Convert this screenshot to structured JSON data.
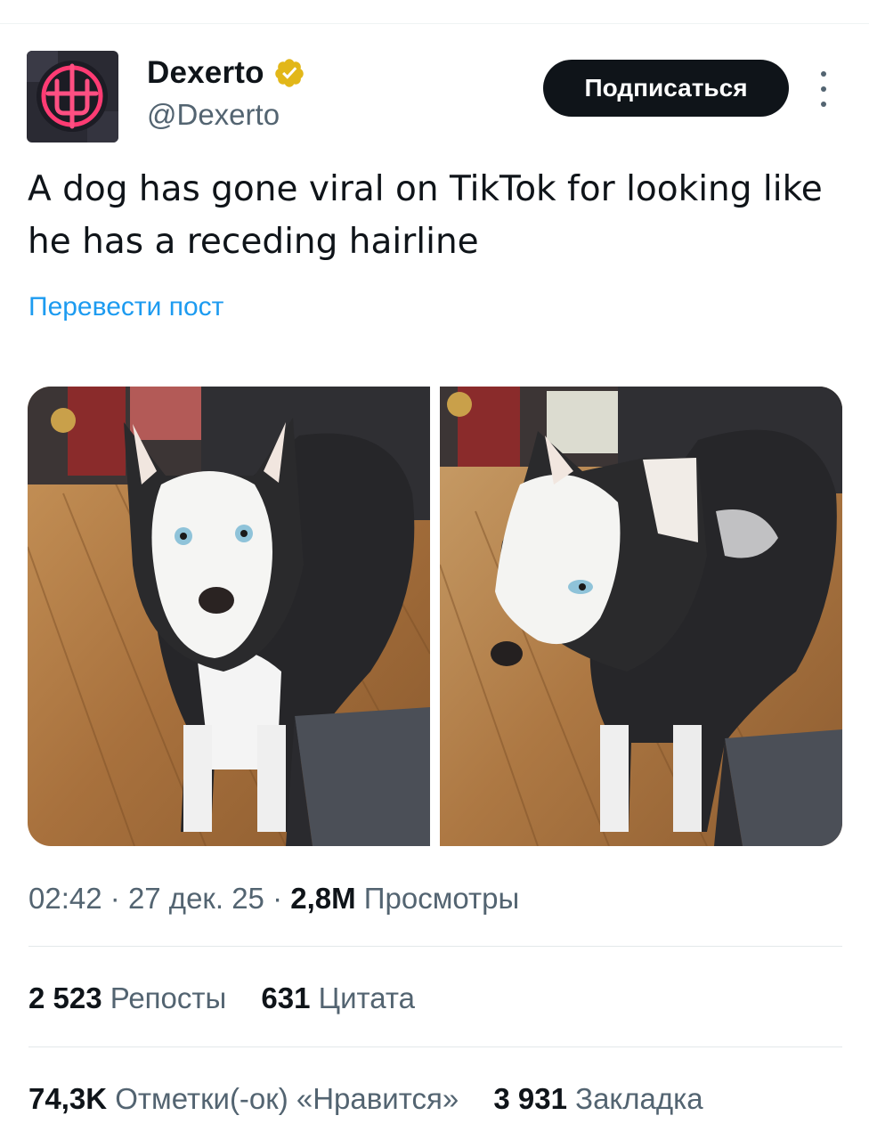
{
  "header": {
    "display_name": "Dexerto",
    "handle": "@Dexerto",
    "follow_label": "Подписаться"
  },
  "tweet": {
    "text": "A dog has gone viral on TikTok for looking like he has a receding hairline",
    "translate_label": "Перевести пост"
  },
  "meta": {
    "time": "02:42",
    "date": "27 дек. 25",
    "views_count": "2,8M",
    "views_label": "Просмотры",
    "separator": "·"
  },
  "stats": {
    "reposts_count": "2 523",
    "reposts_label": "Репосты",
    "quotes_count": "631",
    "quotes_label": "Цитата",
    "likes_count": "74,3K",
    "likes_label": "Отметки(-ок) «Нравится»",
    "bookmarks_count": "3 931",
    "bookmarks_label": "Закладка"
  },
  "icons": {
    "verified": "verified-badge-icon",
    "more": "more-vertical-icon"
  },
  "colors": {
    "link": "#1d9bf0",
    "secondary_text": "#536471",
    "follow_bg": "#0f1419",
    "verified_gold": "#e2b719"
  }
}
